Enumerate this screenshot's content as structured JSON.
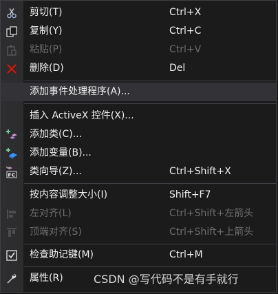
{
  "menu": {
    "items": [
      {
        "label": "剪切(T)",
        "shortcut": "Ctrl+X",
        "icon": "scissors-icon",
        "enabled": true
      },
      {
        "label": "复制(Y)",
        "shortcut": "Ctrl+C",
        "icon": "copy-icon",
        "enabled": true
      },
      {
        "label": "粘贴(P)",
        "shortcut": "Ctrl+V",
        "icon": "paste-icon",
        "enabled": false
      },
      {
        "label": "删除(D)",
        "shortcut": "Del",
        "icon": "delete-icon",
        "enabled": true
      },
      {
        "label": "添加事件处理程序(A)...",
        "shortcut": "",
        "icon": "",
        "enabled": true,
        "highlighted": true
      },
      {
        "label": "插入 ActiveX 控件(X)...",
        "shortcut": "",
        "icon": "",
        "enabled": true
      },
      {
        "label": "添加类(C)...",
        "shortcut": "",
        "icon": "add-class-icon",
        "enabled": true
      },
      {
        "label": "添加变量(B)...",
        "shortcut": "",
        "icon": "add-variable-icon",
        "enabled": true
      },
      {
        "label": "类向导(Z)...",
        "shortcut": "Ctrl+Shift+X",
        "icon": "class-wizard-icon",
        "enabled": true
      },
      {
        "label": "按内容调整大小(I)",
        "shortcut": "Shift+F7",
        "icon": "",
        "enabled": true
      },
      {
        "label": "左对齐(L)",
        "shortcut": "Ctrl+Shift+左箭头",
        "icon": "align-left-icon",
        "enabled": false
      },
      {
        "label": "顶端对齐(S)",
        "shortcut": "Ctrl+Shift+上箭头",
        "icon": "align-top-icon",
        "enabled": false
      },
      {
        "label": "检查助记键(M)",
        "shortcut": "Ctrl+M",
        "icon": "check-mnemonics-icon",
        "enabled": true
      },
      {
        "label": "属性(R)",
        "shortcut": "",
        "icon": "wrench-icon",
        "enabled": true
      }
    ]
  },
  "watermark": "CSDN @写代码不是有手就行",
  "colors": {
    "menu_bg": "#1b1b1c",
    "gutter_bg": "#2d2d30",
    "highlight_bg": "#333337",
    "text": "#f1f1f1",
    "disabled_text": "#6d6d6d",
    "separator": "#3f3f46",
    "delete_red": "#e51400",
    "accent_blue": "#3794ff"
  }
}
